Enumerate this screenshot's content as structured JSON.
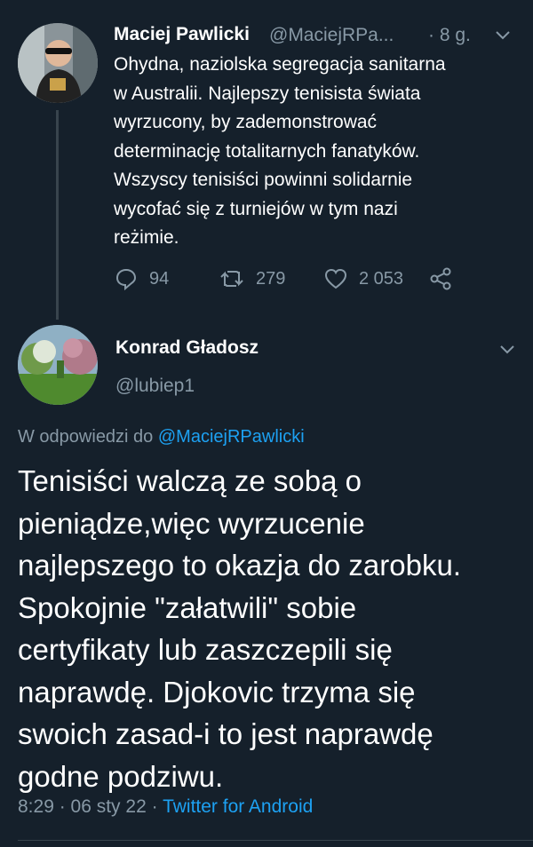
{
  "parent_tweet": {
    "author_name": "Maciej Pawlicki",
    "author_handle": "@MaciejRPa...",
    "time": "· 8 g.",
    "lines": [
      "Ohydna, naziolska segregacja sanitarna",
      "w Australii. Najlepszy tenisista świata",
      "wyrzucony, by zademonstrować",
      "determinację totalitarnych fanatyków.",
      "Wszyscy tenisiści powinni solidarnie",
      "wycofać się z turniejów w tym nazi",
      "reżimie."
    ],
    "replies": "94",
    "retweets": "279",
    "likes": "2 053"
  },
  "reply_tweet": {
    "author_name": "Konrad Gładosz",
    "author_handle": "@lubiep1",
    "replying_prefix": "W odpowiedzi do",
    "replying_mention": "@MaciejRPawlicki",
    "lines": [
      "Tenisiści walczą ze sobą o",
      "pieniądze,więc wyrzucenie",
      "najlepszego to okazja do zarobku.",
      "Spokojnie \"załatwili\" sobie",
      "certyfikaty lub zaszczepili się",
      "naprawdę. Djokovic trzyma się",
      "swoich zasad-i to jest naprawdę",
      "godne podziwu."
    ],
    "timestamp": "8:29 · 06 sty 22 ·",
    "source": "Twitter for Android"
  },
  "colors": {
    "background": "#15202b",
    "text": "#ffffff",
    "secondary": "#8899a6",
    "accent": "#1da1f2",
    "divider": "#38444d"
  },
  "icons": [
    "reply-icon",
    "retweet-icon",
    "like-icon",
    "share-icon",
    "chevron-down-icon"
  ]
}
